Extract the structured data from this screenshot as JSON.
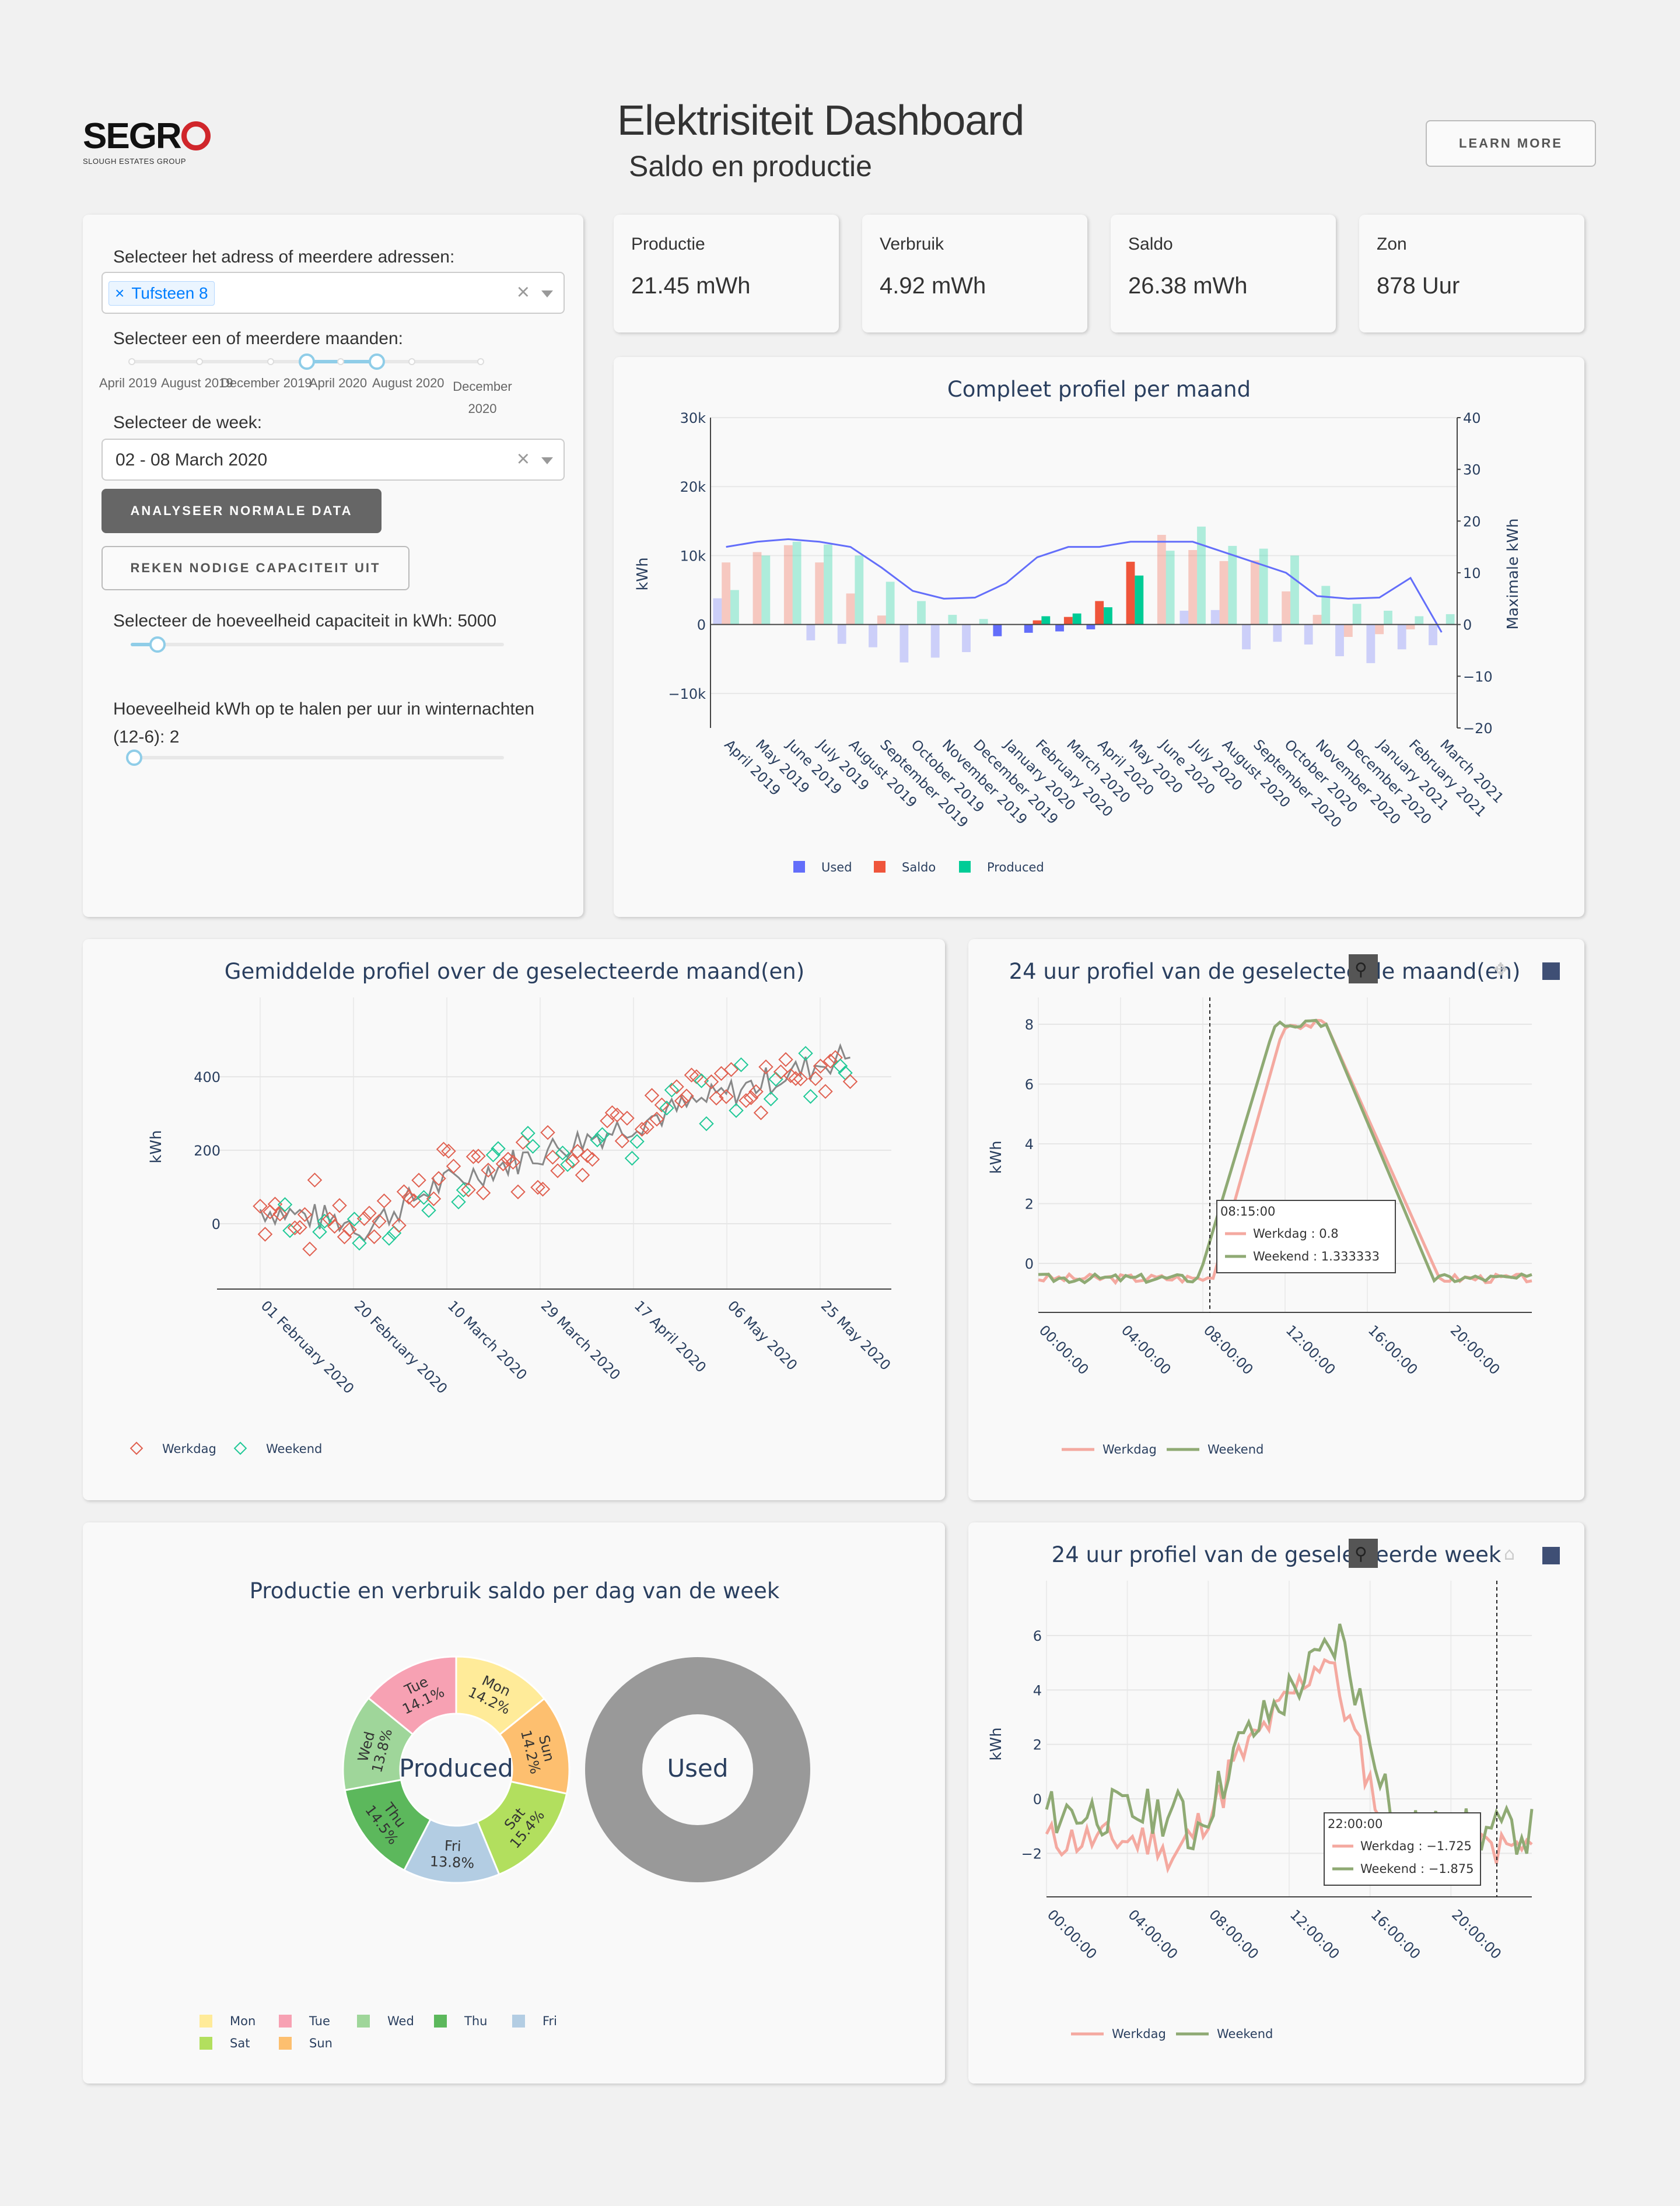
{
  "header": {
    "logo_text": "SEGR",
    "logo_sub": "SLOUGH ESTATES GROUP",
    "title": "Elektrisiteit Dashboard",
    "subtitle": "Saldo en productie",
    "learn_more": "LEARN MORE"
  },
  "controls": {
    "address_label": "Selecteer het adress of meerdere adressen:",
    "address_tag": "Tufsteen 8",
    "months_label": "Selecteer een of meerdere maanden:",
    "month_ticks": [
      "April 2019",
      "August 2019",
      "December 2019",
      "April 2020",
      "August 2020",
      "December 2020"
    ],
    "week_label": "Selecteer de week:",
    "week_value": "02 - 08 March 2020",
    "analyse_button": "ANALYSEER NORMALE DATA",
    "capacity_button": "REKEN NODIGE CAPACITEIT UIT",
    "capacity_label": "Selecteer de hoeveelheid capaciteit in kWh: 5000",
    "night_label": "Hoeveelheid kWh op te halen per uur in winternachten (12-6): 2"
  },
  "kpis": [
    {
      "label": "Productie",
      "value": "21.45 mWh"
    },
    {
      "label": "Verbruik",
      "value": "4.92 mWh"
    },
    {
      "label": "Saldo",
      "value": "26.38 mWh"
    },
    {
      "label": "Zon",
      "value": "878 Uur"
    }
  ],
  "colors": {
    "used": "#636efa",
    "saldo": "#ef553b",
    "produced": "#00cc96",
    "line": "#636efa",
    "werkdag": "#f4a9a0",
    "weekend": "#8faa74",
    "avg_line": "#888888",
    "mon": "#ffeb99",
    "tue": "#f7a1b3",
    "wed": "#9fd69a",
    "thu": "#5cb85c",
    "fri": "#b3cde3",
    "sat": "#b2df5e",
    "sun": "#fdbf6f",
    "used_donut": "#999999"
  },
  "chart_data": [
    {
      "type": "bar",
      "title": "Compleet profiel per maand",
      "ylabel": "kWh",
      "y2label": "Maximale kWh",
      "ylim": [
        -15000,
        30000
      ],
      "y2lim": [
        -20,
        40
      ],
      "yticks": [
        "30k",
        "20k",
        "10k",
        "0",
        "−10k"
      ],
      "y2ticks": [
        "40",
        "30",
        "20",
        "10",
        "0",
        "−10",
        "−20"
      ],
      "categories": [
        "April 2019",
        "May 2019",
        "June 2019",
        "July 2019",
        "August 2019",
        "September 2019",
        "October 2019",
        "November 2019",
        "December 2019",
        "January 2020",
        "February 2020",
        "March 2020",
        "April 2020",
        "May 2020",
        "June 2020",
        "July 2020",
        "August 2020",
        "September 2020",
        "October 2020",
        "November 2020",
        "December 2020",
        "January 2021",
        "February 2021",
        "March 2021"
      ],
      "series": [
        {
          "name": "Used",
          "values": [
            3800,
            0,
            0,
            -2300,
            -2800,
            -3300,
            -5500,
            -4800,
            -4000,
            -1700,
            -1200,
            -1000,
            -700,
            0,
            0,
            0,
            2000,
            2100,
            -3600,
            -2500,
            -2900,
            -4600,
            -5600,
            -3600,
            -3000,
            -2600,
            -2500,
            -1500,
            -1700,
            -1300,
            -800
          ]
        },
        {
          "name": "Saldo",
          "values": []
        },
        {
          "name": "Produced",
          "values": []
        }
      ],
      "series_detail": {
        "used": [
          3800,
          0,
          0,
          -2300,
          -2800,
          -3300,
          -5500,
          -4800,
          -4000,
          -1700,
          -1200,
          -1000,
          -700,
          0,
          0,
          2000,
          2100,
          -3600,
          -2500,
          -2900,
          -4600,
          -5600,
          -3600,
          -3000
        ],
        "saldo": [
          9000,
          10500,
          11500,
          9000,
          4500,
          1300,
          0,
          0,
          0,
          0,
          600,
          1100,
          3400,
          9100,
          13000,
          10800,
          9200,
          9300,
          4800,
          1400,
          -1800,
          -1400,
          -700,
          0
        ],
        "produced": [
          5000,
          10000,
          12000,
          11600,
          10000,
          6200,
          3400,
          1400,
          800,
          0,
          1200,
          1600,
          2500,
          7100,
          10700,
          14200,
          11400,
          11000,
          10000,
          5600,
          3000,
          2000,
          1200,
          1500
        ],
        "max_kwh": [
          15,
          16,
          16.5,
          16,
          15,
          11,
          6.5,
          5,
          5.2,
          8,
          13,
          15,
          15,
          16,
          16,
          16,
          14,
          12,
          10,
          5.5,
          5,
          5.2,
          9,
          -1.5
        ],
        "highlighted_months": [
          "January 2020",
          "February 2020",
          "March 2020",
          "April 2020",
          "May 2020"
        ]
      },
      "legend": [
        "Used",
        "Saldo",
        "Produced"
      ]
    },
    {
      "type": "scatter",
      "title": "Gemiddelde profiel over de geselecteerde maand(en)",
      "ylabel": "kWh",
      "yticks": [
        "400",
        "200",
        "0"
      ],
      "xticks": [
        "01 February 2020",
        "20 February 2020",
        "10 March 2020",
        "29 March 2020",
        "17 April 2020",
        "06 May 2020",
        "25 May 2020"
      ],
      "ylim": [
        -170,
        580
      ],
      "legend": [
        "Werkdag",
        "Weekend"
      ]
    },
    {
      "type": "line",
      "title": "24 uur profiel van de geselecteerde maand(en)",
      "ylabel": "kWh",
      "yticks": [
        "8",
        "6",
        "4",
        "2",
        "0"
      ],
      "xticks": [
        "00:00:00",
        "04:00:00",
        "08:00:00",
        "12:00:00",
        "16:00:00",
        "20:00:00"
      ],
      "ylim": [
        -1.5,
        9
      ],
      "tooltip": {
        "time": "08:15:00",
        "werkdag": "Werkdag : 0.8",
        "weekend": "Weekend : 1.333333"
      },
      "legend": [
        "Werkdag",
        "Weekend"
      ]
    },
    {
      "type": "pie",
      "title": "Productie en verbruik saldo per dag van de week",
      "produced_label": "Produced",
      "used_label": "Used",
      "slices": [
        {
          "day": "Mon",
          "pct": "14.2%",
          "value": 14.2
        },
        {
          "day": "Sun",
          "pct": "14.2%",
          "value": 14.2
        },
        {
          "day": "Sat",
          "pct": "15.4%",
          "value": 15.4
        },
        {
          "day": "Fri",
          "pct": "13.8%",
          "value": 13.8
        },
        {
          "day": "Thu",
          "pct": "14.5%",
          "value": 14.5
        },
        {
          "day": "Wed",
          "pct": "13.8%",
          "value": 13.8
        },
        {
          "day": "Tue",
          "pct": "14.1%",
          "value": 14.1
        }
      ],
      "legend": [
        "Mon",
        "Tue",
        "Wed",
        "Thu",
        "Fri",
        "Sat",
        "Sun"
      ]
    },
    {
      "type": "line",
      "title": "24 uur profiel van de geselecteerde week",
      "ylabel": "kWh",
      "yticks": [
        "6",
        "4",
        "2",
        "0",
        "−2"
      ],
      "xticks": [
        "00:00:00",
        "04:00:00",
        "08:00:00",
        "12:00:00",
        "16:00:00",
        "20:00:00"
      ],
      "ylim": [
        -3.5,
        7.5
      ],
      "tooltip": {
        "time": "22:00:00",
        "werkdag": "Werkdag : −1.725",
        "weekend": "Weekend : −1.875"
      },
      "legend": [
        "Werkdag",
        "Weekend"
      ]
    }
  ]
}
